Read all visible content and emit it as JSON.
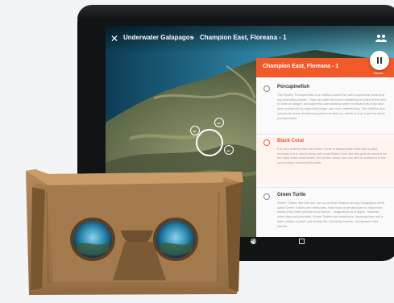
{
  "app": {
    "close_icon": "close-icon",
    "breadcrumb_parent": "Underwater Galapagos",
    "breadcrumb_current": "Champion East, Floreana - 1",
    "people_icon": "people-icon"
  },
  "panel": {
    "header": "Champion East, Floreana - 1",
    "pause_label": "Pause",
    "accent_color": "#f05a2a",
    "entries": [
      {
        "title": "Porcupinefish",
        "body": "The Spotfin Porcupinefish is a medium-sized fish with a spherical head and big protruding spines. They can often be found sheltering in holes in the reef. In case of danger, porcupinefish can swallow water to expand its body and deter predators by appearing larger and more intimidating. The inflation also causes its many threatening spines to stick up, which is how it got the name porcupinefish."
      },
      {
        "title": "Black Coral",
        "body": "It is very unlikely that this Green Turtle is eating what looks like a plant, because it is in fact a living soft coral! Black Coral like this gets its name from the black stalk underneath, the yellow colour you can see is contained in the coral polyps covering this stalk."
      },
      {
        "title": "Green Turtle",
        "body": "Green Turtles, like this one, are a common feature among Galapagos reefs. Adult Green Turtles are herbivores, they have a serrated jaw to help them easily chew their primary food source - seagrasses and algae. However, when they are juveniles, Green Turtles are omnivores. Meaning they eat a wide variety of plant and animal life, including insects, crustaceans and worms."
      }
    ]
  }
}
